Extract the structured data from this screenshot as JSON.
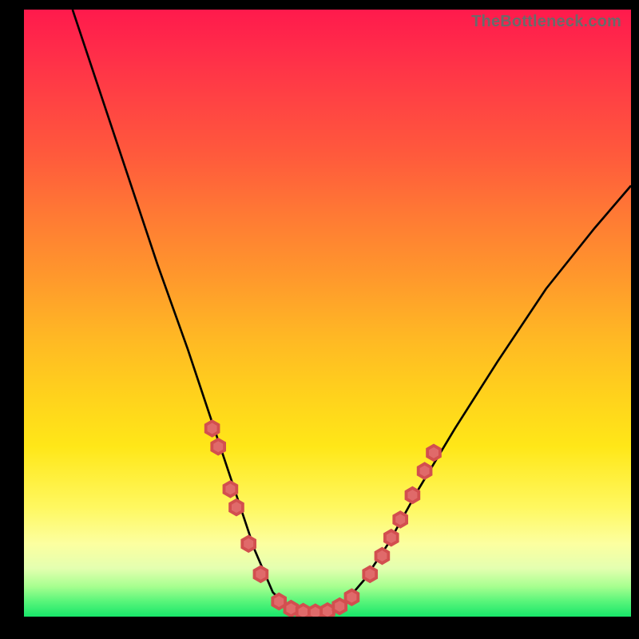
{
  "watermark": "TheBottleneck.com",
  "colors": {
    "frame": "#000000",
    "curve": "#000000",
    "marker_fill": "#e06a6a",
    "marker_stroke": "#d24f4f",
    "gradient_top": "#ff1a4c",
    "gradient_bottom": "#18e66a"
  },
  "chart_data": {
    "type": "line",
    "title": "",
    "xlabel": "",
    "ylabel": "",
    "xlim": [
      0,
      100
    ],
    "ylim": [
      0,
      100
    ],
    "grid": false,
    "legend": false,
    "curve": {
      "description": "V-shaped bottleneck curve; y ≈ 100 falls to ~0 near x≈42, stays near 0 until x≈52, rises to ~70 at x=100",
      "points": [
        {
          "x": 8,
          "y": 100
        },
        {
          "x": 12,
          "y": 88
        },
        {
          "x": 17,
          "y": 73
        },
        {
          "x": 22,
          "y": 58
        },
        {
          "x": 27,
          "y": 44
        },
        {
          "x": 31,
          "y": 32
        },
        {
          "x": 35,
          "y": 20
        },
        {
          "x": 38,
          "y": 11
        },
        {
          "x": 41,
          "y": 4
        },
        {
          "x": 44,
          "y": 1
        },
        {
          "x": 47,
          "y": 0.5
        },
        {
          "x": 50,
          "y": 0.8
        },
        {
          "x": 53,
          "y": 2.5
        },
        {
          "x": 56,
          "y": 6
        },
        {
          "x": 60,
          "y": 12
        },
        {
          "x": 65,
          "y": 21
        },
        {
          "x": 71,
          "y": 31
        },
        {
          "x": 78,
          "y": 42
        },
        {
          "x": 86,
          "y": 54
        },
        {
          "x": 94,
          "y": 64
        },
        {
          "x": 100,
          "y": 71
        }
      ]
    },
    "markers": {
      "shape": "hexagon",
      "radius": 1.2,
      "points": [
        {
          "x": 31,
          "y": 31
        },
        {
          "x": 32,
          "y": 28
        },
        {
          "x": 34,
          "y": 21
        },
        {
          "x": 35,
          "y": 18
        },
        {
          "x": 37,
          "y": 12
        },
        {
          "x": 39,
          "y": 7
        },
        {
          "x": 42,
          "y": 2.5
        },
        {
          "x": 44,
          "y": 1.3
        },
        {
          "x": 46,
          "y": 0.8
        },
        {
          "x": 48,
          "y": 0.7
        },
        {
          "x": 50,
          "y": 0.9
        },
        {
          "x": 52,
          "y": 1.7
        },
        {
          "x": 54,
          "y": 3.2
        },
        {
          "x": 57,
          "y": 7
        },
        {
          "x": 59,
          "y": 10
        },
        {
          "x": 60.5,
          "y": 13
        },
        {
          "x": 62,
          "y": 16
        },
        {
          "x": 64,
          "y": 20
        },
        {
          "x": 66,
          "y": 24
        },
        {
          "x": 67.5,
          "y": 27
        }
      ]
    }
  }
}
